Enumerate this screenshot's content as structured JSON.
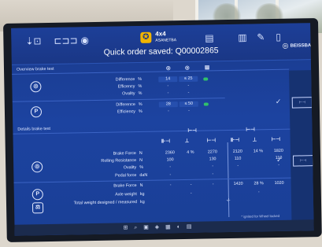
{
  "app": {
    "logo_primary": "4x4",
    "logo_secondary": "ASANETBA",
    "order_text": "Quick order saved: Q00002865",
    "brand": "BEISSBARTH"
  },
  "sections": {
    "overview_title": "Overview brake test",
    "details_title": "Details brake test"
  },
  "overview": {
    "rows": [
      {
        "label": "Difference",
        "unit": "%",
        "v1": "14",
        "v2": "≤ 25"
      },
      {
        "label": "Efficency",
        "unit": "%",
        "v1": "-",
        "v2": "-"
      },
      {
        "label": "Ovality",
        "unit": "%",
        "v1": "-",
        "v2": "-"
      },
      {
        "label": "Difference",
        "unit": "%",
        "v1": "28",
        "v2": "≤ 50"
      },
      {
        "label": "Efficiency",
        "unit": "%",
        "v1": "-",
        "v2": "-"
      }
    ]
  },
  "details": {
    "rows": [
      {
        "label": "Brake Force",
        "unit": "N",
        "c1": "2360",
        "c2": "4 %",
        "c3": "2270",
        "c4": "2120",
        "c5": "14 %",
        "c6": "1820"
      },
      {
        "label": "Rolling Resistance",
        "unit": "N",
        "c1": "100",
        "c2": "",
        "c3": "130",
        "c4": "110",
        "c5": "",
        "c6": "110"
      },
      {
        "label": "Ovality",
        "unit": "%",
        "c1": "-",
        "c2": "",
        "c3": "-",
        "c4": "-",
        "c5": "",
        "c6": "-"
      },
      {
        "label": "Pedal force",
        "unit": "daN",
        "c1": "-",
        "c2": "",
        "c3": "-",
        "c4": "",
        "c5": "",
        "c6": ""
      },
      {
        "label": "Brake Force",
        "unit": "N",
        "c1": "-",
        "c2": "-",
        "c3": "-",
        "c4": "1420",
        "c5": "28 %",
        "c6": "1020"
      },
      {
        "label": "Axle weight",
        "unit": "kg",
        "c1": "",
        "c2": "-",
        "c3": "",
        "c4": "",
        "c5": "-",
        "c6": ""
      },
      {
        "label": "Total weight designed / measured",
        "unit": "kg",
        "c1": "",
        "c2": "",
        "c3": "",
        "c4": "-/-",
        "c5": "",
        "c6": ""
      }
    ]
  },
  "footnote": "* ignited for Wheel locked",
  "colors": {
    "screen_bg": "#1c43a0",
    "accent_yellow": "#f0b400",
    "ok_green": "#31c06b"
  }
}
